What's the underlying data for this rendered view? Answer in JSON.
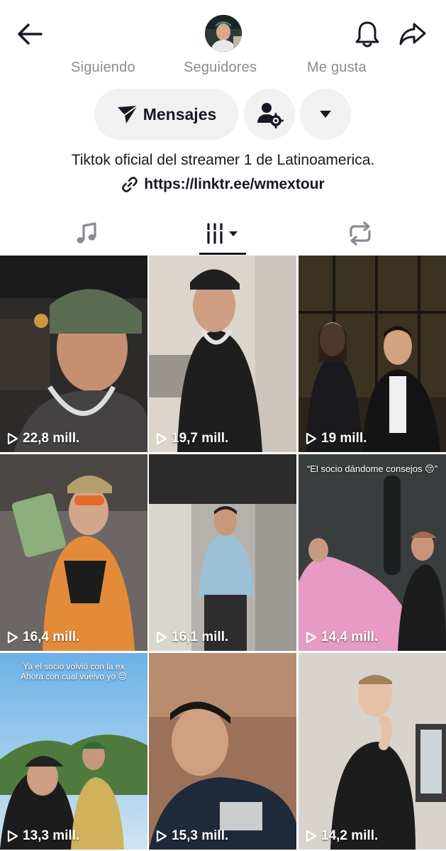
{
  "header": {
    "back_icon": "arrow-left-icon",
    "bell_icon": "bell-icon",
    "share_icon": "share-arrow-icon"
  },
  "stats": {
    "following_label": "Siguiendo",
    "followers_label": "Seguidores",
    "likes_label": "Me gusta"
  },
  "actions": {
    "messages_label": "Mensajes",
    "messages_icon": "paper-plane-icon",
    "friends_settings_icon": "person-gear-icon",
    "more_icon": "caret-down-icon"
  },
  "bio": {
    "text": "Tiktok oficial del streamer 1 de Latinoamerica.",
    "link": "https://linktr.ee/wmextour",
    "link_icon": "link-icon"
  },
  "tabs": [
    {
      "name": "sounds",
      "icon": "music-note-icon"
    },
    {
      "name": "videos",
      "icon": "grid-filter-icon",
      "active": true
    },
    {
      "name": "reposts",
      "icon": "repost-icon"
    }
  ],
  "videos": [
    {
      "views": "22,8 mill."
    },
    {
      "views": "19,7 mill."
    },
    {
      "views": "19 mill."
    },
    {
      "views": "16,4 mill."
    },
    {
      "views": "16,1 mill."
    },
    {
      "views": "14,4 mill.",
      "caption": "“El socio dándome consejos 😔”"
    },
    {
      "views": "13,3 mill.",
      "caption_line1": "Ya el socio volvió con la ex",
      "caption_line2": "Ahora con cual vuelvo yo 😔"
    },
    {
      "views": "15,3 mill."
    },
    {
      "views": "14,2 mill."
    }
  ],
  "colors": {
    "text": "#161823",
    "muted": "#8a8b91",
    "button_bg": "#f1f1f2"
  }
}
